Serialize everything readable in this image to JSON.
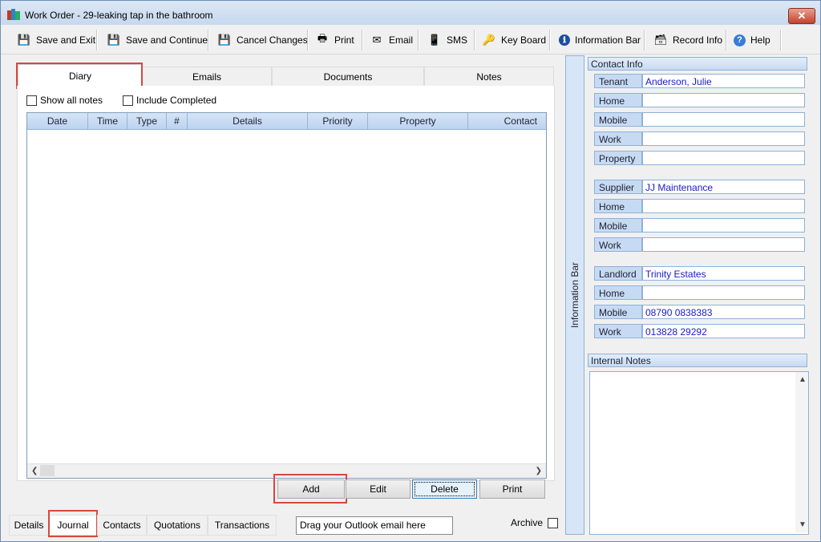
{
  "window": {
    "title": "Work Order -  29-leaking tap in the bathroom",
    "close_label": "✕"
  },
  "toolbar": [
    {
      "label": "Save and Exit",
      "icon": "save-exit-icon",
      "glyph": "💾"
    },
    {
      "label": "Save and Continue",
      "icon": "save-continue-icon",
      "glyph": "💾"
    },
    {
      "label": "Cancel Changes",
      "icon": "cancel-changes-icon",
      "glyph": "💾"
    },
    {
      "label": "Print",
      "icon": "printer-icon",
      "glyph": "🖶"
    },
    {
      "label": "Email",
      "icon": "email-icon",
      "glyph": "✉"
    },
    {
      "label": "SMS",
      "icon": "phone-icon",
      "glyph": "📱"
    },
    {
      "label": "Key Board",
      "icon": "keys-icon",
      "glyph": "🔑"
    },
    {
      "label": "Information Bar",
      "icon": "info-icon",
      "glyph": "ℹ"
    },
    {
      "label": "Record Info",
      "icon": "record-info-icon",
      "glyph": "🗃"
    },
    {
      "label": "Help",
      "icon": "help-icon",
      "glyph": "?"
    }
  ],
  "tabs": [
    "Diary",
    "Emails",
    "Documents",
    "Notes"
  ],
  "active_tab": "Diary",
  "options": {
    "show_all_notes": "Show all notes",
    "include_completed": "Include Completed"
  },
  "grid": {
    "columns": [
      "Date",
      "Time",
      "Type",
      "#",
      "Details",
      "Priority",
      "Property",
      "Contact"
    ],
    "rows": []
  },
  "actions": {
    "add": "Add",
    "edit": "Edit",
    "delete": "Delete",
    "print": "Print"
  },
  "bottom_tabs": [
    "Details",
    "Journal",
    "Contacts",
    "Quotations",
    "Transactions"
  ],
  "active_bottom_tab": "Journal",
  "drag_hint": "Drag your Outlook email here",
  "archive_label": "Archive",
  "info_bar_label": "Information Bar",
  "contact_info": {
    "heading": "Contact Info",
    "tenant": [
      {
        "label": "Tenant",
        "value": "Anderson, Julie"
      },
      {
        "label": "Home",
        "value": ""
      },
      {
        "label": "Mobile",
        "value": ""
      },
      {
        "label": "Work",
        "value": ""
      },
      {
        "label": "Property",
        "value": ""
      }
    ],
    "supplier": [
      {
        "label": "Supplier",
        "value": "JJ Maintenance"
      },
      {
        "label": "Home",
        "value": ""
      },
      {
        "label": "Mobile",
        "value": ""
      },
      {
        "label": "Work",
        "value": ""
      }
    ],
    "landlord": [
      {
        "label": "Landlord",
        "value": "Trinity Estates"
      },
      {
        "label": "Home",
        "value": ""
      },
      {
        "label": "Mobile",
        "value": "08790 0838383"
      },
      {
        "label": "Work",
        "value": "013828 29292"
      }
    ]
  },
  "internal_notes": {
    "heading": "Internal Notes",
    "text": ""
  },
  "colors": {
    "highlight": "#d9473f",
    "link_value": "#1a1ac8",
    "panel_blue": "#c6dbf3"
  }
}
